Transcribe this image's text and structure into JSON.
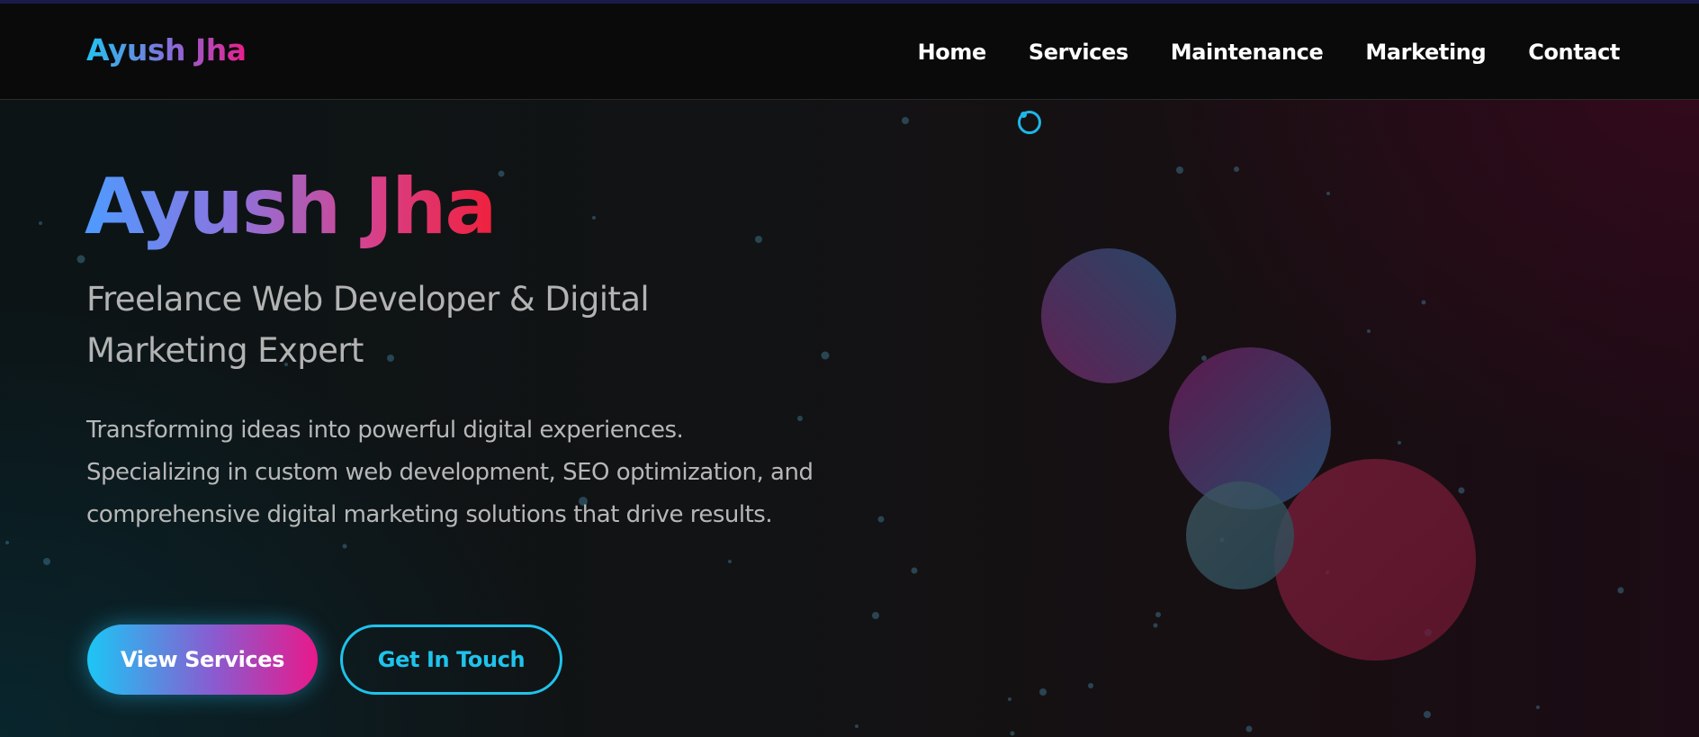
{
  "header": {
    "logo_text": "Ayush Jha",
    "nav": [
      {
        "label": "Home"
      },
      {
        "label": "Services"
      },
      {
        "label": "Maintenance"
      },
      {
        "label": "Marketing"
      },
      {
        "label": "Contact"
      }
    ]
  },
  "hero": {
    "title": "Ayush Jha",
    "subtitle": "Freelance Web Developer & Digital Marketing Expert",
    "description": "Transforming ideas into powerful digital experiences. Specializing in custom web development, SEO optimization, and comprehensive digital marketing solutions that drive results.",
    "primary_button": "View Services",
    "secondary_button": "Get In Touch"
  },
  "icons": {
    "loading": "loading-spinner-icon"
  },
  "colors": {
    "accent_cyan": "#1fc3ec",
    "accent_pink": "#e8198a",
    "accent_blue": "#4e9bff",
    "accent_red": "#f0203c",
    "background": "#0b0b0c",
    "nav_background": "#0a0a0a"
  }
}
